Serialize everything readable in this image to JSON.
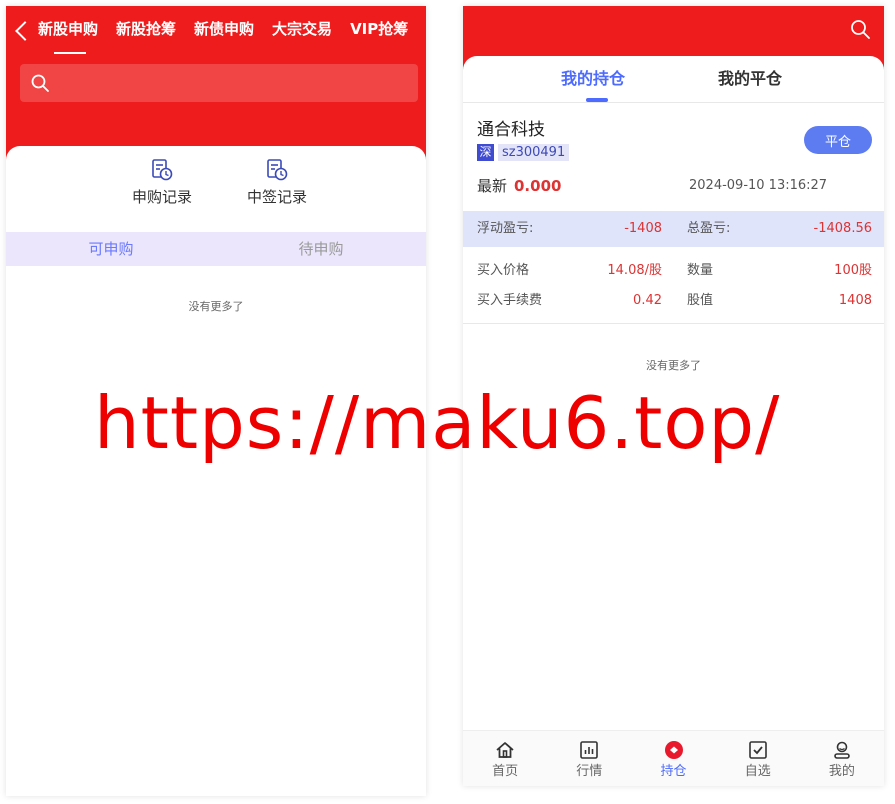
{
  "left": {
    "tabs": [
      "新股申购",
      "新股抢筹",
      "新债申购",
      "大宗交易",
      "VIP抢筹"
    ],
    "search": {
      "placeholder": ""
    },
    "records": [
      {
        "label": "申购记录",
        "icon": "record-clock-icon"
      },
      {
        "label": "中签记录",
        "icon": "record-clock-icon"
      }
    ],
    "subtabs": [
      "可申购",
      "待申购"
    ],
    "no_more": "没有更多了"
  },
  "right": {
    "tabs": [
      "我的持仓",
      "我的平仓"
    ],
    "position": {
      "name": "通合科技",
      "market_badge": "深",
      "code": "sz300491",
      "close_label": "平仓",
      "latest_label": "最新",
      "latest_value": "0.000",
      "timestamp": "2024-09-10 13:16:27",
      "floating_pnl_label": "浮动盈亏:",
      "floating_pnl_value": "-1408",
      "total_pnl_label": "总盈亏:",
      "total_pnl_value": "-1408.56",
      "buy_price_label": "买入价格",
      "buy_price_value": "14.08/股",
      "quantity_label": "数量",
      "quantity_value": "100股",
      "fee_label": "买入手续费",
      "fee_value": "0.42",
      "market_value_label": "股值",
      "market_value_value": "1408"
    },
    "no_more": "没有更多了",
    "nav": [
      {
        "label": "首页",
        "icon": "home-icon"
      },
      {
        "label": "行情",
        "icon": "chart-icon"
      },
      {
        "label": "持仓",
        "icon": "position-icon"
      },
      {
        "label": "自选",
        "icon": "checkbox-icon"
      },
      {
        "label": "我的",
        "icon": "profile-icon"
      }
    ]
  },
  "watermark": "https://maku6.top/",
  "colors": {
    "brand_red": "#ee1c1c",
    "accent_blue": "#4d6bff",
    "loss_red": "#dd3333"
  }
}
